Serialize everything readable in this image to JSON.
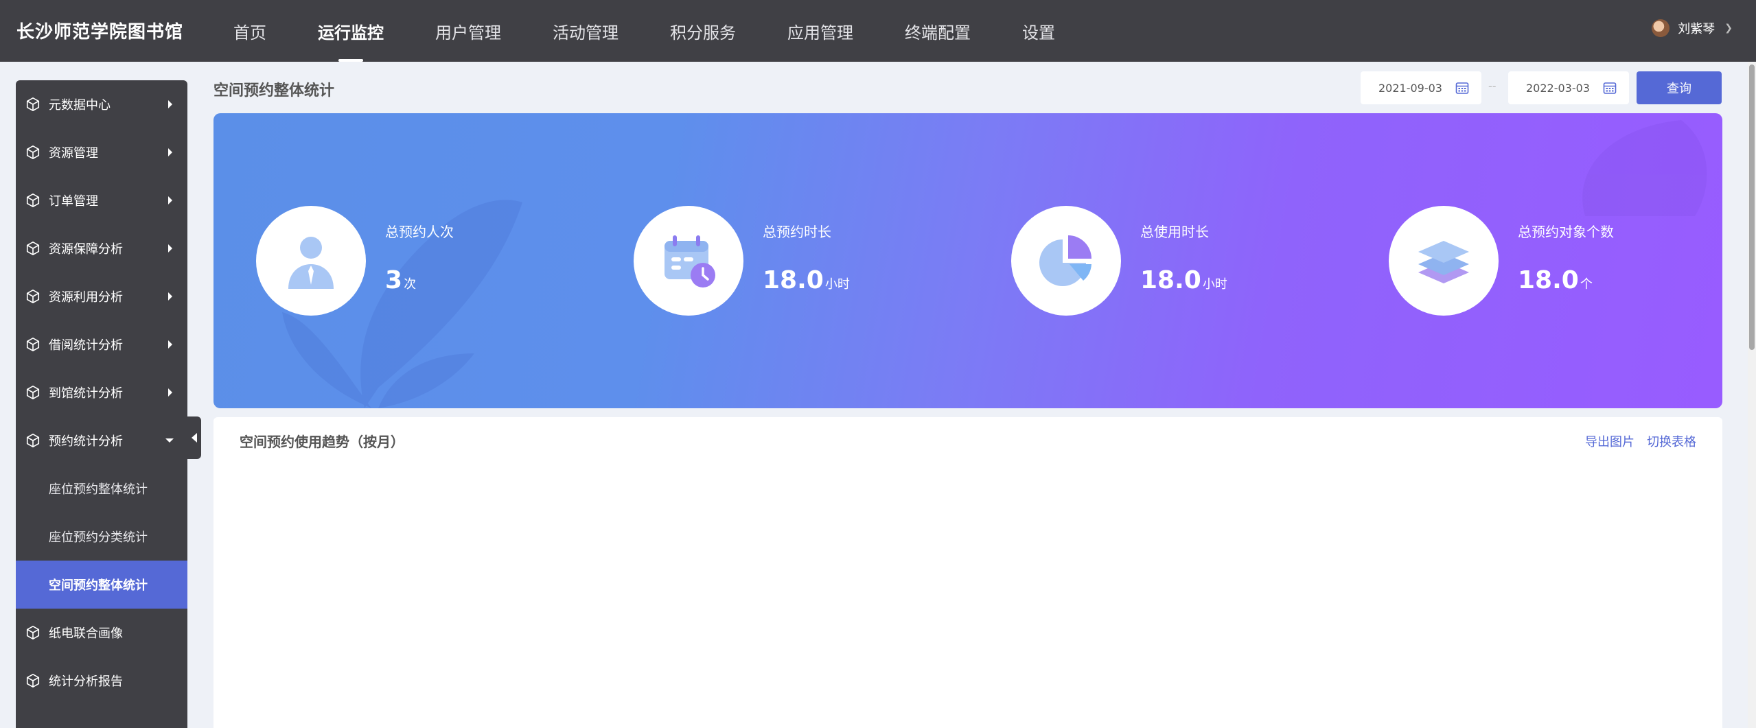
{
  "header": {
    "brand": "长沙师范学院图书馆",
    "nav": [
      {
        "label": "首页",
        "active": false
      },
      {
        "label": "运行监控",
        "active": true
      },
      {
        "label": "用户管理",
        "active": false
      },
      {
        "label": "活动管理",
        "active": false
      },
      {
        "label": "积分服务",
        "active": false
      },
      {
        "label": "应用管理",
        "active": false
      },
      {
        "label": "终端配置",
        "active": false
      },
      {
        "label": "设置",
        "active": false
      }
    ],
    "user": {
      "name": "刘紫琴"
    }
  },
  "sidebar": {
    "items": [
      {
        "label": "元数据中心"
      },
      {
        "label": "资源管理"
      },
      {
        "label": "订单管理"
      },
      {
        "label": "资源保障分析"
      },
      {
        "label": "资源利用分析"
      },
      {
        "label": "借阅统计分析"
      },
      {
        "label": "到馆统计分析"
      },
      {
        "label": "预约统计分析",
        "expanded": true
      },
      {
        "label": "纸电联合画像"
      },
      {
        "label": "统计分析报告"
      }
    ],
    "subitems": [
      {
        "label": "座位预约整体统计",
        "active": false
      },
      {
        "label": "座位预约分类统计",
        "active": false
      },
      {
        "label": "空间预约整体统计",
        "active": true
      }
    ]
  },
  "main": {
    "title": "空间预约整体统计",
    "date_start": "2021-09-03",
    "date_sep": "--",
    "date_end": "2022-03-03",
    "query_label": "查询",
    "stats": [
      {
        "label": "总预约人次",
        "value": "3",
        "unit": "次",
        "icon": "user-icon"
      },
      {
        "label": "总预约时长",
        "value": "18.0",
        "unit": "小时",
        "icon": "calendar-clock-icon"
      },
      {
        "label": "总使用时长",
        "value": "18.0",
        "unit": "小时",
        "icon": "pie-chart-icon"
      },
      {
        "label": "总预约对象个数",
        "value": "18.0",
        "unit": "个",
        "icon": "layers-icon"
      }
    ],
    "trend_panel": {
      "title": "空间预约使用趋势（按月）",
      "export_label": "导出图片",
      "toggle_label": "切换表格"
    }
  },
  "colors": {
    "topbar": "#404045",
    "accent": "#5569d6",
    "banner_start": "#5b8fe8",
    "banner_end": "#985cff"
  }
}
